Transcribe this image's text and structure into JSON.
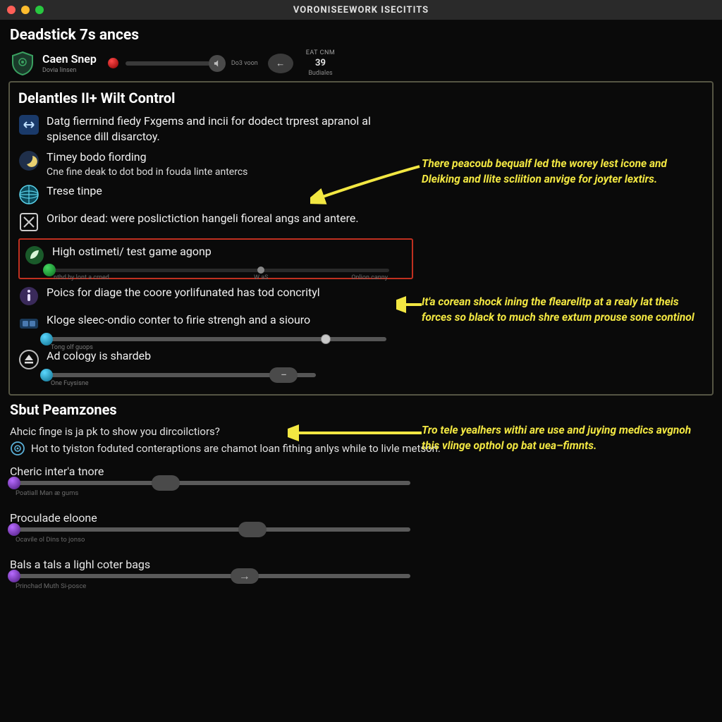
{
  "window": {
    "title": "VORONISEEWORK ISECITITS"
  },
  "header": {
    "section_title": "Deadstick 7s ances",
    "item_label": "Caen Snep",
    "item_sub": "Dovia linsen",
    "mid_label": "Do3 voon",
    "cap_top": "EAT CNM",
    "cap_value": "39",
    "cap_sub": "Budiales"
  },
  "panel": {
    "title": "Delantles II+ Wilt Control",
    "opts": [
      {
        "icon": "arrows-icon",
        "text": "Datg fierrnind fiedy Fxgems and incii for dodect trprest apranol al spisence dill disarctoy."
      },
      {
        "icon": "moon-icon",
        "text": "Timey bodo fiording",
        "sub": "Cne fine deak to dot bod in fouda linte antercs"
      },
      {
        "icon": "globe-icon",
        "text": "Trese tinpe"
      },
      {
        "icon": "cross-box-icon",
        "text": "Oribor dead: were poslictiction hangeli fioreal angs and antere."
      }
    ],
    "highlight": {
      "icon": "leaf-icon",
      "text": "High ostimeti/ test game agonp",
      "sub_left": "nthd by lont a crned",
      "mid_label": "W aS",
      "right_label": "Onlion canny"
    },
    "opts2": [
      {
        "icon": "info-icon",
        "text": "Poics for diage the coore yorlifunated has tod concrityl"
      },
      {
        "icon": "device-icon",
        "text": "Kloge sleec-ondio conter to firie strengh and a siouro",
        "slider_sub": "Tong olf guops"
      },
      {
        "icon": "eject-icon",
        "text": "Ad cology is shardeb",
        "slider_sub": "One Fuysisne"
      }
    ]
  },
  "callouts": {
    "c1": "There peacoub bequalf led the worey lest icone and Dleiking and llite scliition anvige for joyter lextirs.",
    "c2": "It'a corean shock ining the flearelitp at a realy lat theis forces so black to much shre extum prouse sone continol",
    "c3": "Tro tele yealhers withi are use and juying medics avgnoh this vlinge opthol op bat uea–fimnts."
  },
  "lower": {
    "title": "Sbut Peamzones",
    "question": "Ahcic finge is ja pk to show you dircoilctiors?",
    "info": "Hot to tyiston foduted conteraptions are chamot loan fithing anlys while to livle metson.",
    "sliders": [
      {
        "label": "Cheric inter'a tnore",
        "sub": "Poatiall Man æ gums",
        "thumb": "big",
        "pos": 38
      },
      {
        "label": "Proculade eloone",
        "sub": "Ocavile ol Dins to jonso",
        "thumb": "big",
        "pos": 60
      },
      {
        "label": "Bals a tals a lighl coter bags",
        "sub": "Princhad Muth Si-posce",
        "thumb": "arrow",
        "pos": 58
      }
    ]
  }
}
